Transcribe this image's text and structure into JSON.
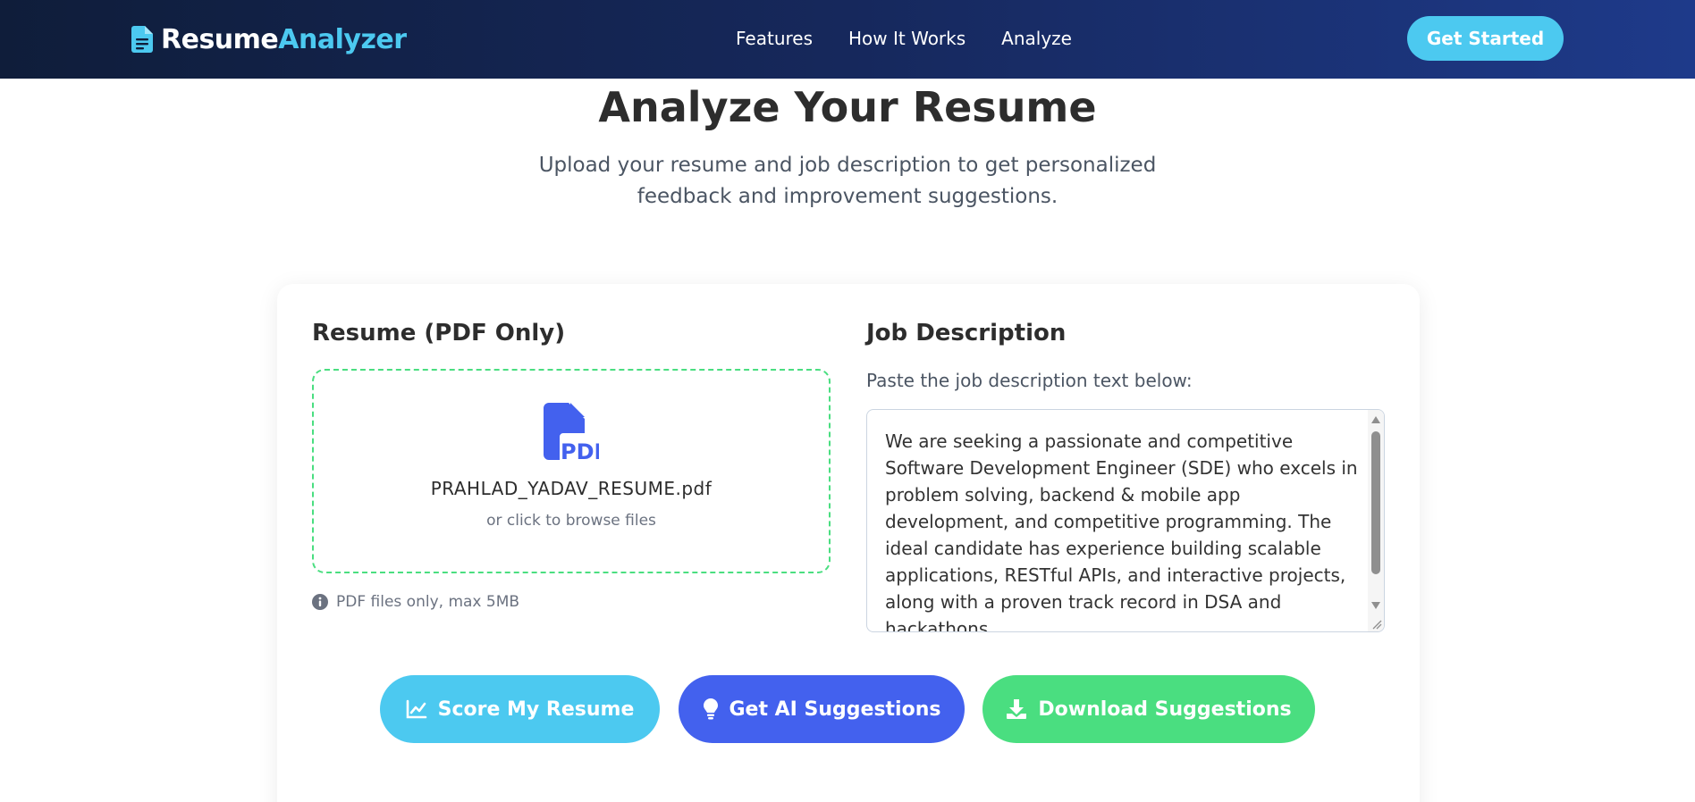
{
  "nav": {
    "logo_part1": "Resume",
    "logo_part2": "Analyzer",
    "links": [
      "Features",
      "How It Works",
      "Analyze"
    ],
    "cta": "Get Started"
  },
  "hero": {
    "title": "Analyze Your Resume",
    "subtitle": "Upload your resume and job description to get personalized feedback and improvement suggestions."
  },
  "resume": {
    "title": "Resume (PDF Only)",
    "pdf_badge": "PDF",
    "file_name": "PRAHLAD_YADAV_RESUME.pdf",
    "browse_hint": "or click to browse files",
    "note": "PDF files only, max 5MB"
  },
  "job": {
    "title": "Job Description",
    "label": "Paste the job description text below:",
    "text": "We are seeking a passionate and competitive Software Development Engineer (SDE) who excels in problem solving, backend & mobile app development, and competitive programming. The ideal candidate has experience building scalable applications, RESTful APIs, and interactive projects, along with a proven track record in DSA and hackathons."
  },
  "actions": {
    "score": "Score My Resume",
    "ai": "Get AI Suggestions",
    "download": "Download Suggestions"
  },
  "colors": {
    "accent": "#4cc9f0",
    "primary": "#4361ee",
    "success": "#4ade80",
    "nav_dark": "#0f1d3a",
    "nav_blue": "#1e3a8a"
  },
  "icons": [
    "file-icon",
    "pdf-file-icon",
    "info-icon",
    "chart-line-icon",
    "lightbulb-icon",
    "download-icon"
  ]
}
